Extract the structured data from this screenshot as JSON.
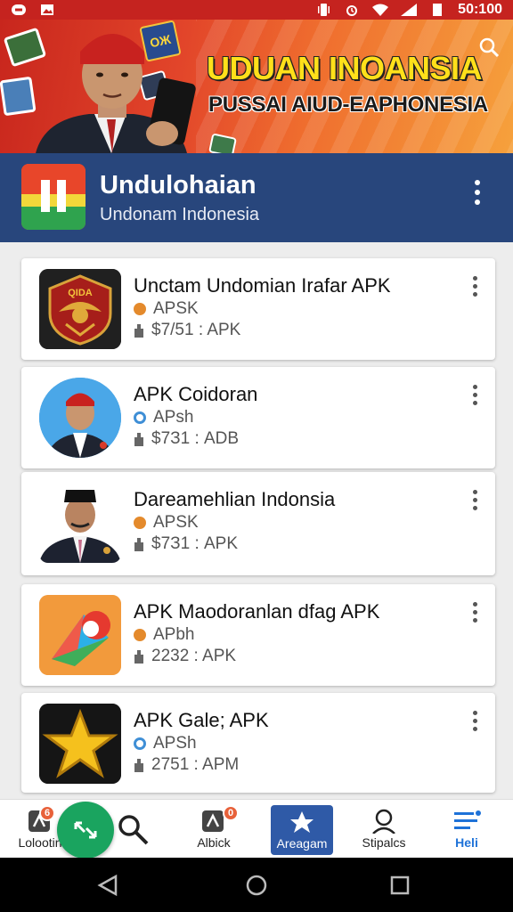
{
  "status_bar": {
    "time": "50:100"
  },
  "banner": {
    "title": "UDUAN INOANSIA",
    "subtitle": "PUSSAI AIUD-EAPHONESIA",
    "card_text": "OЖ"
  },
  "app_bar": {
    "title": "Undulohaian",
    "subtitle": "Undonam Indonesia"
  },
  "apps": [
    {
      "title": "Unctam Undomian Irafar APK",
      "badge": "APSK",
      "size": "$7/51 : APK",
      "badge_color": "#e48a2c",
      "thumb": "emblem",
      "emblem_text": "QIDA"
    },
    {
      "title": "APK Coidoran",
      "badge": "APsh",
      "size": "$7З1 : ADB",
      "badge_color": "#3f8fd6",
      "thumb": "portrait1"
    },
    {
      "title": "Dareamehlian Indonsia",
      "badge": "APSK",
      "size": "$7З1 : APK",
      "badge_color": "#e48a2c",
      "thumb": "portrait2"
    },
    {
      "title": "APK Maodoranlan dfag APK",
      "badge": "APbh",
      "size": "2232 : APK",
      "badge_color": "#e48a2c",
      "thumb": "colorful"
    },
    {
      "title": "APK Gale; APK",
      "badge": "APSh",
      "size": "2751 : APM",
      "badge_color": "#3f8fd6",
      "thumb": "star"
    }
  ],
  "bottom_nav": {
    "items": [
      {
        "label": "Lolootin",
        "badge": "6"
      },
      {
        "label": "Albick",
        "badge": "0"
      },
      {
        "label": "Areagam"
      },
      {
        "label": "Stipalcs"
      },
      {
        "label": "Heli"
      }
    ]
  },
  "colors": {
    "status_bar": "#c5231f",
    "app_bar": "#28467c",
    "active_tab": "#2f5aa7",
    "fab": "#1aa45f",
    "help_blue": "#1e72d8"
  }
}
